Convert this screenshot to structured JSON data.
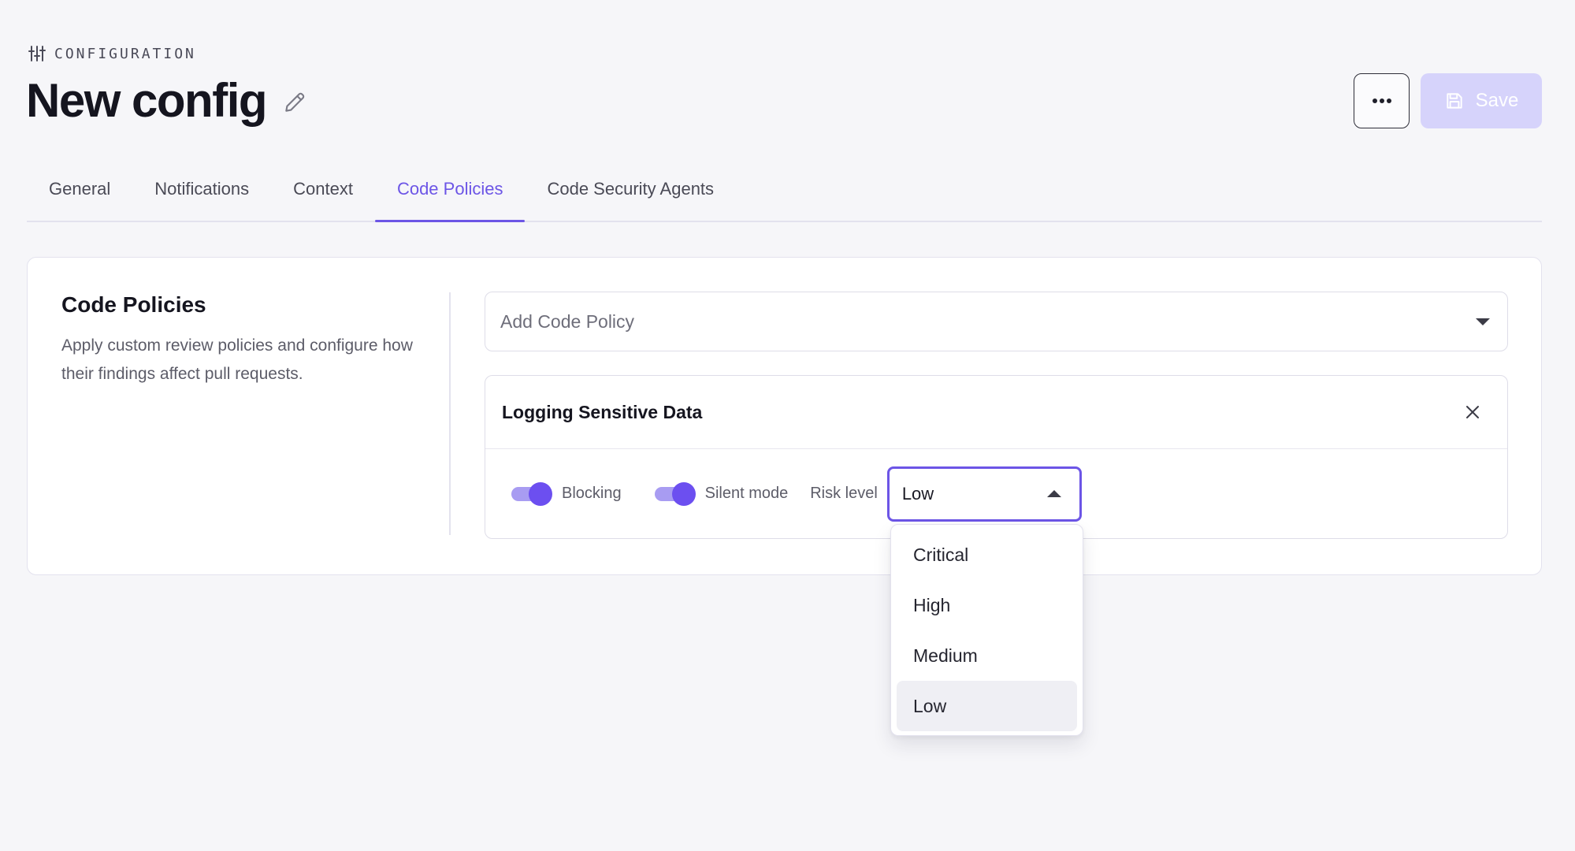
{
  "header": {
    "eyebrow": "CONFIGURATION",
    "title": "New config",
    "save_label": "Save"
  },
  "tabs": [
    {
      "label": "General",
      "active": false
    },
    {
      "label": "Notifications",
      "active": false
    },
    {
      "label": "Context",
      "active": false
    },
    {
      "label": "Code Policies",
      "active": true
    },
    {
      "label": "Code Security Agents",
      "active": false
    }
  ],
  "section": {
    "title": "Code Policies",
    "description": "Apply custom review policies and configure how their findings affect pull requests."
  },
  "add_policy": {
    "placeholder": "Add Code Policy"
  },
  "policy": {
    "title": "Logging Sensitive Data",
    "blocking": {
      "label": "Blocking",
      "on": true
    },
    "silent_mode": {
      "label": "Silent mode",
      "on": true
    },
    "risk_label": "Risk level",
    "risk_value": "Low",
    "risk_options": [
      "Critical",
      "High",
      "Medium",
      "Low"
    ]
  },
  "colors": {
    "accent": "#6c55e6",
    "save_disabled": "#d6d3fb",
    "toggle_knob": "#6c4ff0",
    "toggle_track": "#a89cf2",
    "background": "#f6f6f9"
  },
  "icons": {
    "eyebrow": "sliders-icon",
    "edit": "pencil-icon",
    "more": "ellipsis-icon",
    "save": "floppy-disk-icon",
    "close": "close-icon",
    "dropdown": "caret-down-icon",
    "risk_dropdown": "caret-up-icon"
  }
}
